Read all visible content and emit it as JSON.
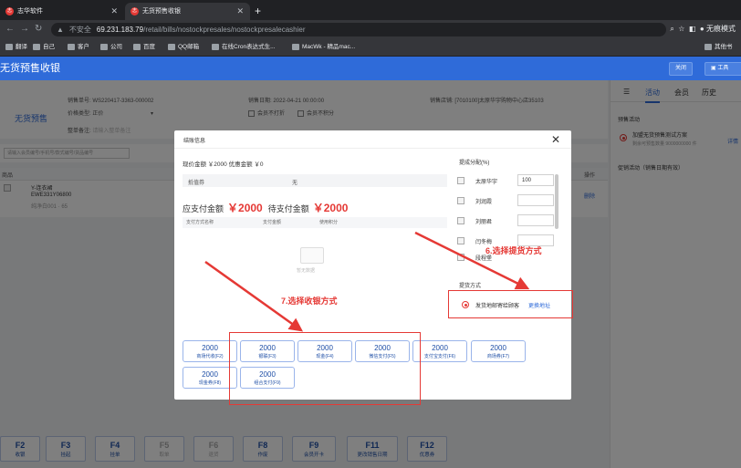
{
  "browser": {
    "tabs": [
      {
        "label": "志华软件",
        "icon": "logo-icon"
      },
      {
        "label": "无货预售收银",
        "icon": "logo-icon"
      }
    ],
    "address_warning": "不安全",
    "address_host": "69.231.183.79",
    "address_path": "/retail/bills/nostockpresales/nostockpresalecashier",
    "profile": "无痕模式",
    "bookmarks": [
      "翻译",
      "自己",
      "客户",
      "公司",
      "百度",
      "QQ邮箱",
      "在线Cron表达式生...",
      "MacWk - 精品mac..."
    ],
    "other_bookmarks": "其他书"
  },
  "app": {
    "title": "无货预售收银",
    "close_btn": "关闭",
    "tools_btn": "工具",
    "section_title": "无货预售",
    "fields": {
      "order_no_label": "销售单号:",
      "order_no": "WS220417-3363-000002",
      "price_type_label": "价格类型:",
      "price_type": "正价",
      "remark_label": "整单备注:",
      "remark_placeholder": "请输入整单备注",
      "sale_date_label": "销售日期:",
      "sale_date": "2022-04-21 00:00:00",
      "no_print": "会员不打折",
      "no_points": "会员不积分",
      "store_label": "销售店铺:",
      "store": "[7010100]太原华宇购物中心店35103"
    },
    "search_placeholder": "请输入会员编号/手机号/款式编号/货品编号",
    "table_head_goods": "商品",
    "table_head_op": "操作",
    "row": {
      "name": "Y-连衣裙",
      "code": "EWE331Y06800",
      "sku": "纯净白001 · 65",
      "op": "删除"
    }
  },
  "sidebar": {
    "tabs": [
      "活动",
      "会员",
      "历史"
    ],
    "presale_title": "预售活动",
    "activity_name": "加盟无货预售测试方案",
    "activity_sub": "剩余可预售数量 9000000000 件",
    "detail_link": "详情",
    "promo_title": "促销活动（销售日期有效）"
  },
  "fkeys": [
    {
      "key": "F2",
      "label": "收银",
      "enabled": true
    },
    {
      "key": "F3",
      "label": "挂起",
      "enabled": true
    },
    {
      "key": "F4",
      "label": "挂单",
      "enabled": true
    },
    {
      "key": "F5",
      "label": "取单",
      "enabled": false
    },
    {
      "key": "F6",
      "label": "退货",
      "enabled": false
    },
    {
      "key": "F8",
      "label": "作废",
      "enabled": true
    },
    {
      "key": "F9",
      "label": "会员开卡",
      "enabled": true
    },
    {
      "key": "F11",
      "label": "更改销售日期",
      "enabled": true
    },
    {
      "key": "F12",
      "label": "优惠券",
      "enabled": true
    }
  ],
  "modal": {
    "title": "结账信息",
    "summary": "现价金额 ￥2000  优惠金额 ￥0",
    "voucher_label": "抵值券",
    "voucher_value": "无",
    "due_label": "应支付金额",
    "due_value": "￥2000",
    "pending_label": "待支付金额",
    "pending_value": "￥2000",
    "pay_table_cols": [
      "支付方式名称",
      "支付金额",
      "使用积分"
    ],
    "empty_text": "暂无数据",
    "pay_methods": [
      {
        "amount": "2000",
        "name": "商场代收(F2)"
      },
      {
        "amount": "2000",
        "name": "银联(F3)"
      },
      {
        "amount": "2000",
        "name": "现金(F4)"
      },
      {
        "amount": "2000",
        "name": "微信支付(F5)"
      },
      {
        "amount": "2000",
        "name": "支付宝支付(F6)"
      },
      {
        "amount": "2000",
        "name": "商场券(F7)"
      },
      {
        "amount": "2000",
        "name": "现金券(F8)"
      },
      {
        "amount": "2000",
        "name": "组合支付(F9)"
      }
    ],
    "commission_title": "提成分配(%)",
    "commission": [
      {
        "name": "太原华宇",
        "value": "100"
      },
      {
        "name": "刘润霞",
        "value": ""
      },
      {
        "name": "刘丽君",
        "value": ""
      },
      {
        "name": "闫冬梅",
        "value": ""
      },
      {
        "name": "段程堡",
        "value": ""
      }
    ],
    "delivery_title": "提货方式",
    "delivery_option": "发货地邮寄给顾客",
    "change_address": "更换地址"
  },
  "annotations": {
    "step6": "6.选择提货方式",
    "step7": "7.选择收银方式"
  },
  "colors": {
    "accent": "#2f6bd9",
    "price": "#e53935",
    "annotation": "#e53935"
  }
}
